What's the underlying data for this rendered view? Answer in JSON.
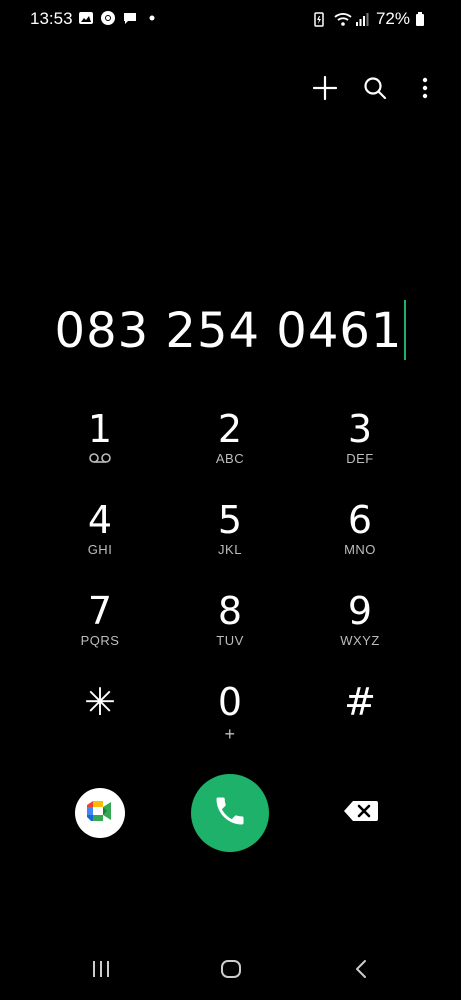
{
  "status": {
    "time": "13:53",
    "left_icons": [
      "gallery-icon",
      "chrome-icon",
      "chat-icon",
      "dot-icon"
    ],
    "right_icons": [
      "battery-saver-icon",
      "wifi-icon",
      "signal-icon"
    ],
    "battery": "72%"
  },
  "top_actions": [
    "add-icon",
    "search-icon",
    "more-icon"
  ],
  "dialer": {
    "number": "083 254 0461"
  },
  "keypad": [
    [
      {
        "digit": "1",
        "letters": "",
        "sub_icon": "voicemail-icon"
      },
      {
        "digit": "2",
        "letters": "ABC"
      },
      {
        "digit": "3",
        "letters": "DEF"
      }
    ],
    [
      {
        "digit": "4",
        "letters": "GHI"
      },
      {
        "digit": "5",
        "letters": "JKL"
      },
      {
        "digit": "6",
        "letters": "MNO"
      }
    ],
    [
      {
        "digit": "7",
        "letters": "PQRS"
      },
      {
        "digit": "8",
        "letters": "TUV"
      },
      {
        "digit": "9",
        "letters": "WXYZ"
      }
    ],
    [
      {
        "digit": "✳",
        "letters": ""
      },
      {
        "digit": "0",
        "letters": "+"
      },
      {
        "digit": "#",
        "letters": ""
      }
    ]
  ],
  "colors": {
    "background": "#000000",
    "call_button": "#1db16a",
    "cursor": "#1db16a"
  }
}
